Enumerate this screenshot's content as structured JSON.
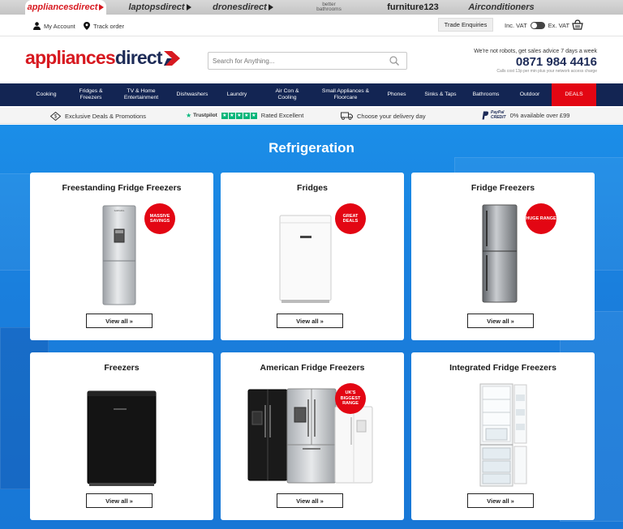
{
  "site_tabs": [
    {
      "label": "appliancesdirect",
      "active": true
    },
    {
      "label": "laptopsdirect",
      "active": false
    },
    {
      "label": "dronesdirect",
      "active": false
    },
    {
      "label": "better bathrooms",
      "active": false
    },
    {
      "label": "furniture123",
      "active": false
    },
    {
      "label": "Airconditioners",
      "active": false
    }
  ],
  "utility": {
    "account": "My Account",
    "track": "Track order",
    "trade": "Trade Enquiries",
    "inc_vat": "Inc. VAT",
    "ex_vat": "Ex. VAT"
  },
  "header": {
    "logo_part1": "appliances",
    "logo_part2": "direct",
    "search_placeholder": "Search for Anything...",
    "sales_advice": "We're not robots, get sales advice 7 days a week",
    "phone": "0871 984 4416",
    "call_note": "Calls cost 13p per min plus your network access charge"
  },
  "nav": [
    "Cooking",
    "Fridges & Freezers",
    "TV & Home Entertainment",
    "Dishwashers",
    "Laundry",
    "Air Con & Cooling",
    "Small Appliances & Floorcare",
    "Phones",
    "Sinks & Taps",
    "Bathrooms",
    "Outdoor",
    "DEALS"
  ],
  "promo": {
    "exclusive": "Exclusive Deals & Promotions",
    "trustpilot": "Trustpilot",
    "rated": "Rated Excellent",
    "delivery": "Choose your delivery day",
    "paypal_line1": "PayPal",
    "paypal_line2": "CREDIT",
    "paypal_text": "0% available over £99"
  },
  "page_title": "Refrigeration",
  "cards": [
    {
      "title": "Freestanding Fridge Freezers",
      "badge": "MASSIVE SAVINGS",
      "view": "View all »"
    },
    {
      "title": "Fridges",
      "badge": "GREAT DEALS",
      "view": "View all »"
    },
    {
      "title": "Fridge Freezers",
      "badge": "HUGE RANGE",
      "view": "View all »"
    },
    {
      "title": "Freezers",
      "badge": "",
      "view": "View all »"
    },
    {
      "title": "American Fridge Freezers",
      "badge": "UK'S BIGGEST RANGE",
      "view": "View all »"
    },
    {
      "title": "Integrated Fridge Freezers",
      "badge": "",
      "view": "View all »"
    }
  ],
  "colors": {
    "brand_red": "#d71920",
    "brand_navy": "#1d2b57",
    "nav_bg": "#132553",
    "deals_red": "#e30613",
    "hero_blue": "#1a86e3",
    "trustpilot_green": "#00b67a"
  },
  "icons": {
    "account": "person-icon",
    "track": "location-pin-icon",
    "basket": "basket-icon",
    "search": "search-icon",
    "promo_exclusive": "tag-icon",
    "delivery": "truck-icon"
  }
}
